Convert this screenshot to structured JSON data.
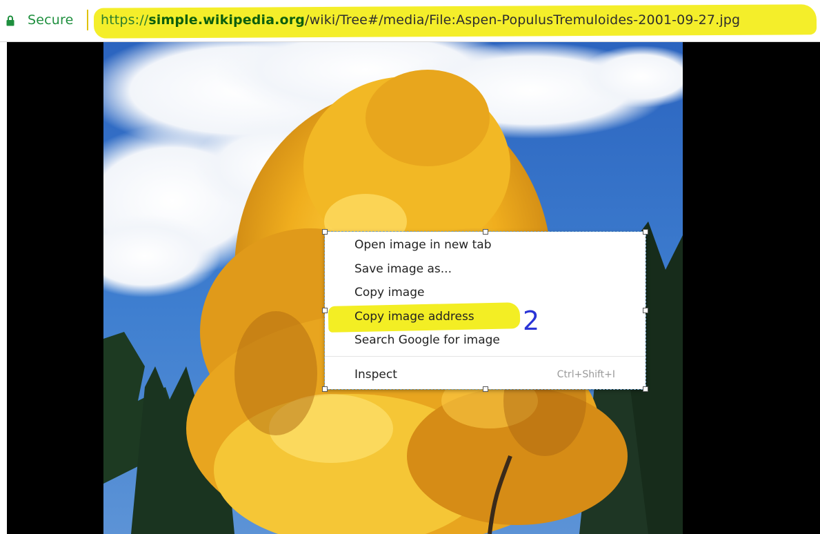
{
  "address_bar": {
    "security_label": "Secure",
    "url": {
      "scheme": "https://",
      "domain": "simple.wikipedia.org",
      "path": "/wiki/Tree#/media/File:Aspen-PopulusTremuloides-2001-09-27.jpg"
    },
    "highlight_color": "#f4ee2a"
  },
  "image": {
    "subject": "aspen-tree-photo",
    "dominant_colors": [
      "#2f6fc4",
      "#e8a820",
      "#1f3b2a",
      "#ffffff"
    ]
  },
  "context_menu": {
    "items": [
      {
        "label": "Open image in new tab",
        "shortcut": ""
      },
      {
        "label": "Save image as...",
        "shortcut": ""
      },
      {
        "label": "Copy image",
        "shortcut": ""
      },
      {
        "label": "Copy image address",
        "shortcut": "",
        "highlighted": true
      },
      {
        "label": "Search Google for image",
        "shortcut": ""
      },
      {
        "label": "Inspect",
        "shortcut": "Ctrl+Shift+I"
      }
    ]
  },
  "annotation": {
    "step": "2",
    "color": "#2a34d6"
  }
}
